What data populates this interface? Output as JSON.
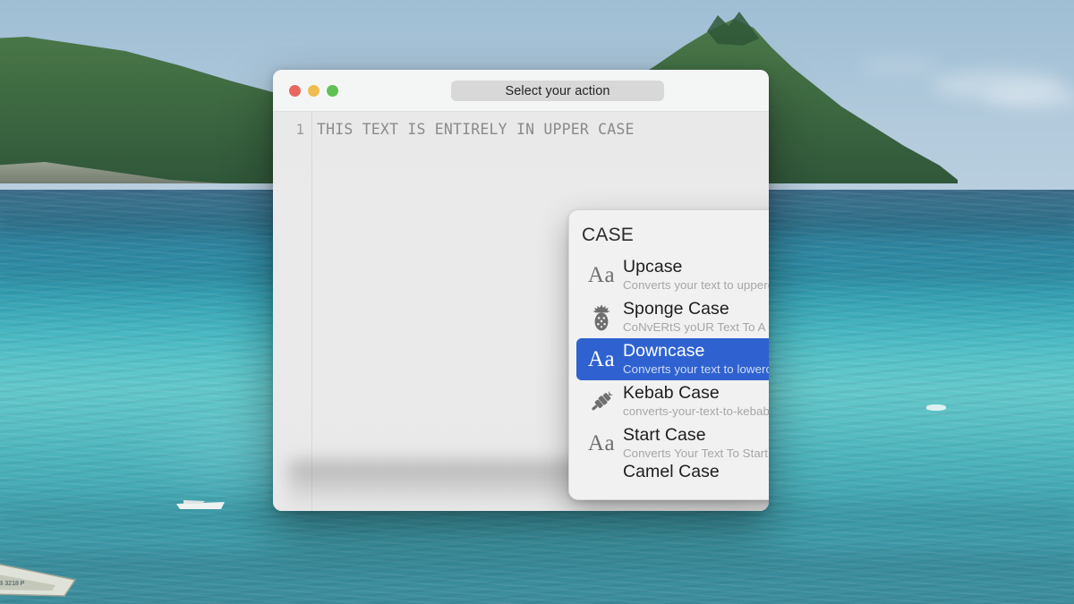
{
  "desktop": {
    "wallpaper_description": "tropical island with forested hill, blue sky and turquoise ocean with small boats",
    "colors": {
      "sky": "#aec8da",
      "sea_deep": "#357690",
      "sea_shallow": "#62c7c9",
      "island": "#3f6b42"
    }
  },
  "window": {
    "titlebar": {
      "action_button_label": "Select your action",
      "traffic_lights": [
        {
          "name": "close",
          "color": "#e8685e"
        },
        {
          "name": "minimize",
          "color": "#efbc4f"
        },
        {
          "name": "zoom",
          "color": "#60c153"
        }
      ]
    },
    "editor": {
      "line_number": "1",
      "line_text": "THIS TEXT IS ENTIRELY IN UPPER CASE"
    }
  },
  "popover": {
    "header": "CASE",
    "accent_color": "#2f62d0",
    "items": [
      {
        "icon": "aa-letters-icon",
        "icon_glyph": "Aa",
        "title": "Upcase",
        "description": "Converts your text to uppercase.",
        "selected": false
      },
      {
        "icon": "pineapple-icon",
        "icon_glyph": "",
        "title": "Sponge Case",
        "description": "CoNvERtS yoUR Text To A HIghER fOrM Of CoMMUnICAtIOn",
        "selected": false
      },
      {
        "icon": "aa-letters-icon",
        "icon_glyph": "Aa",
        "title": "Downcase",
        "description": "Converts your text to lowercase.",
        "selected": true
      },
      {
        "icon": "kebab-skewer-icon",
        "icon_glyph": "",
        "title": "Kebab Case",
        "description": "converts-your-text-to-kebab-case.",
        "selected": false
      },
      {
        "icon": "aa-letters-icon",
        "icon_glyph": "Aa",
        "title": "Start Case",
        "description": "Converts Your Text To Start Case.",
        "selected": false
      }
    ],
    "partial_item": {
      "title": "Camel Case"
    }
  }
}
